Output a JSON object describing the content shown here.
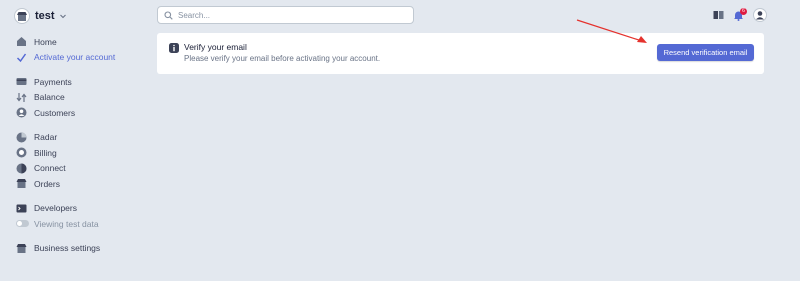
{
  "account": {
    "name": "test"
  },
  "search": {
    "placeholder": "Search..."
  },
  "nav": {
    "home": "Home",
    "activate": "Activate your account",
    "payments": "Payments",
    "balance": "Balance",
    "customers": "Customers",
    "radar": "Radar",
    "billing": "Billing",
    "connect": "Connect",
    "orders": "Orders",
    "developers": "Developers",
    "viewing_test_data": "Viewing test data",
    "business_settings": "Business settings"
  },
  "notifications": {
    "count": "6"
  },
  "banner": {
    "title": "Verify your email",
    "description": "Please verify your email before activating your account.",
    "button": "Resend verification email"
  },
  "colors": {
    "accent": "#5469d4",
    "background": "#e3e8ef",
    "annotation_arrow": "#e5322d",
    "badge": "#df1b41"
  }
}
